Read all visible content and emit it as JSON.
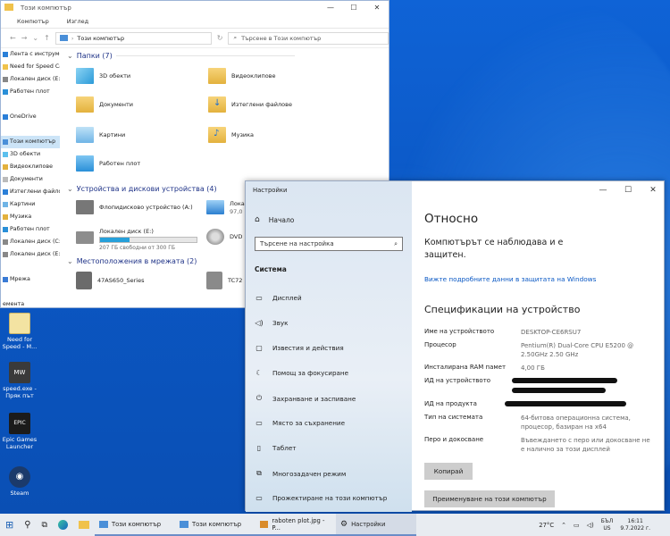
{
  "explorer": {
    "title": "Този компютър",
    "ribbon": [
      "Компютър",
      "Изглед"
    ],
    "address": "Този компютър",
    "search_placeholder": "Търсене в Този компютър",
    "nav": [
      {
        "label": "Лента с инструменти",
        "icon": "star-icon"
      },
      {
        "label": "Need for Speed Car",
        "icon": "folder-icon"
      },
      {
        "label": "Локален диск (E:)",
        "icon": "drive-icon"
      },
      {
        "label": "Работен плот",
        "icon": "desktop-icon"
      },
      {
        "label": "",
        "icon": ""
      },
      {
        "label": "OneDrive",
        "icon": "cloud-icon"
      },
      {
        "label": "",
        "icon": ""
      },
      {
        "label": "Този компютър",
        "icon": "pc-icon"
      },
      {
        "label": "3D обекти",
        "icon": "cube-icon"
      },
      {
        "label": "Видеоклипове",
        "icon": "film-icon"
      },
      {
        "label": "Документи",
        "icon": "document-icon"
      },
      {
        "label": "Изтеглени файлов",
        "icon": "download-icon"
      },
      {
        "label": "Картини",
        "icon": "picture-icon"
      },
      {
        "label": "Музика",
        "icon": "music-icon"
      },
      {
        "label": "Работен плот",
        "icon": "desktop-icon"
      },
      {
        "label": "Локален диск (C:)",
        "icon": "drive-icon"
      },
      {
        "label": "Локален диск (E:)",
        "icon": "drive-icon"
      },
      {
        "label": "",
        "icon": ""
      },
      {
        "label": "Мрежа",
        "icon": "network-icon"
      },
      {
        "label": "",
        "icon": ""
      },
      {
        "label": "емента",
        "icon": ""
      }
    ],
    "folders_group": "Папки (7)",
    "folders": [
      "3D обекти",
      "Видеоклипове",
      "Документи",
      "Изтеглени файлове",
      "Картини",
      "Музика",
      "Работен плот"
    ],
    "devices_group": "Устройства и дискови устройства (4)",
    "devices": {
      "floppy": "Флопидисково устройство (A:)",
      "c_label": "Локал",
      "c_size": "97,0",
      "e_label": "Локален диск (E:)",
      "e_free": "207 ГБ свободни от 300 ГБ",
      "e_fill": 0.31,
      "dvd": "DVD"
    },
    "network_group": "Местоположения в мрежата (2)",
    "network": [
      "47AS650_Series",
      "TC72"
    ]
  },
  "desktop": [
    {
      "label": "Need for Speed - M...",
      "color": "#e9d48a"
    },
    {
      "label": "speed.exe - Пряк път",
      "color": "#3a3a3a"
    },
    {
      "label": "Epic Games Launcher",
      "color": "#1b1b1b"
    },
    {
      "label": "Steam",
      "color": "#1b3a6b"
    }
  ],
  "settings": {
    "title": "Настройки",
    "home": "Начало",
    "search_placeholder": "Търсене на настройка",
    "section": "Система",
    "items": [
      {
        "label": "Дисплей",
        "icon": "monitor-icon",
        "glyph": "▭"
      },
      {
        "label": "Звук",
        "icon": "speaker-icon",
        "glyph": "◁)"
      },
      {
        "label": "Известия и действия",
        "icon": "notification-icon",
        "glyph": "▢"
      },
      {
        "label": "Помощ за фокусиране",
        "icon": "moon-icon",
        "glyph": "☾"
      },
      {
        "label": "Захранване и заспиване",
        "icon": "power-icon",
        "glyph": "⏻"
      },
      {
        "label": "Място за съхранение",
        "icon": "storage-icon",
        "glyph": "▭"
      },
      {
        "label": "Таблет",
        "icon": "tablet-icon",
        "glyph": "▯"
      },
      {
        "label": "Многозадачен режим",
        "icon": "multitask-icon",
        "glyph": "⧉"
      },
      {
        "label": "Прожектиране на този компютър",
        "icon": "project-icon",
        "glyph": "▭"
      }
    ],
    "heading": "Относно",
    "warning": "Компютърът се наблюдава и е защитен.",
    "link": "Вижте подробните данни в защитата на Windows",
    "spec_heading": "Спецификации на устройство",
    "specs": [
      {
        "k": "Име на устройството",
        "v": "DESKTOP-CE6RSU7"
      },
      {
        "k": "Процесор",
        "v": "Pentium(R) Dual-Core  CPU      E5200 @ 2.50GHz   2.50 GHz"
      },
      {
        "k": "Инсталирана RAM памет",
        "v": "4,00 ГБ"
      },
      {
        "k": "ИД на устройството",
        "v": ""
      },
      {
        "k": "ИД на продукта",
        "v": ""
      },
      {
        "k": "Тип на системата",
        "v": "64-битова операционна система, процесор, базиран на x64"
      },
      {
        "k": "Перо и докосване",
        "v": "Въвеждането с перо или докосване не е налично за този дисплей"
      }
    ],
    "copy": "Копирай",
    "rename": "Преименуване на този компютър"
  },
  "taskbar": {
    "apps": [
      "Този компютър",
      "Този компютър",
      "raboten plot.jpg - P...",
      "Настройки"
    ],
    "temp": "27°C",
    "lang": "БЪЛ",
    "lang2": "US",
    "time": "16:11",
    "date": "9.7.2022 г."
  }
}
